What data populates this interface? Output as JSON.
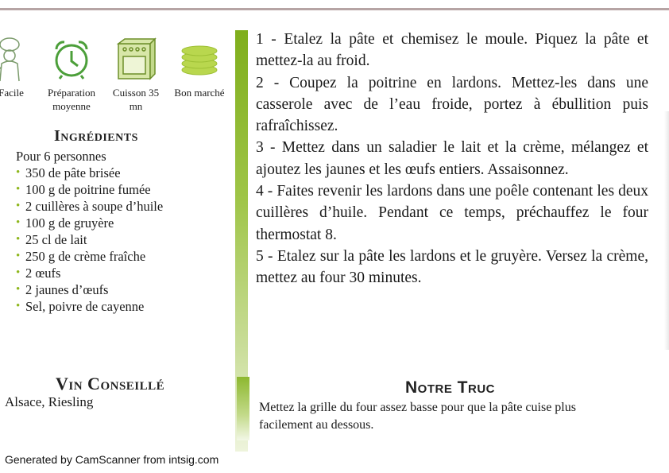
{
  "icons": [
    {
      "label": "Facile",
      "icon": "chef-icon"
    },
    {
      "label": "Préparation moyenne",
      "icon": "alarm-clock-icon"
    },
    {
      "label": "Cuisson 35 mn",
      "icon": "oven-icon"
    },
    {
      "label": "Bon marché",
      "icon": "coins-icon"
    }
  ],
  "ingredients": {
    "title": "Ingrédients",
    "servings": "Pour 6 personnes",
    "items": [
      "350 de pâte brisée",
      "100 g de poitrine fumée",
      "2 cuillères à soupe d’huile",
      "100 g de gruyère",
      "25 cl de lait",
      "250 g de crème fraîche",
      "2 œufs",
      "2 jaunes d’œufs",
      "Sel, poivre de cayenne"
    ]
  },
  "steps": [
    "1 - Etalez la pâte et chemisez le moule. Piquez la pâte et mettez-la au froid.",
    "2 - Coupez la poitrine en lardons. Mettez-les dans une casserole avec de l’eau froide, portez à ébullition puis rafraîchissez.",
    "3 - Mettez dans un saladier le lait et la crème, mélangez et ajoutez les jaunes et les œufs entiers. Assaisonnez.",
    "4 - Faites revenir les lardons dans une poêle contenant les deux cuillères d’huile. Pendant ce temps, préchauffez le four thermostat 8.",
    "5 - Etalez sur la pâte les lardons et le gruyère. Versez la crème, mettez au four 30 minutes."
  ],
  "vin": {
    "title": "Vin Conseillé",
    "text": "Alsace, Riesling"
  },
  "truc": {
    "title": "Notre Truc",
    "text": "Mettez la grille du four assez basse pour que la pâte cuise plus facilement au dessous."
  },
  "footer": "Generated by CamScanner from intsig.com",
  "colors": {
    "accent_green": "#7fae1c",
    "icon_green": "#5aa83a",
    "coin_green": "#b5d44a"
  }
}
